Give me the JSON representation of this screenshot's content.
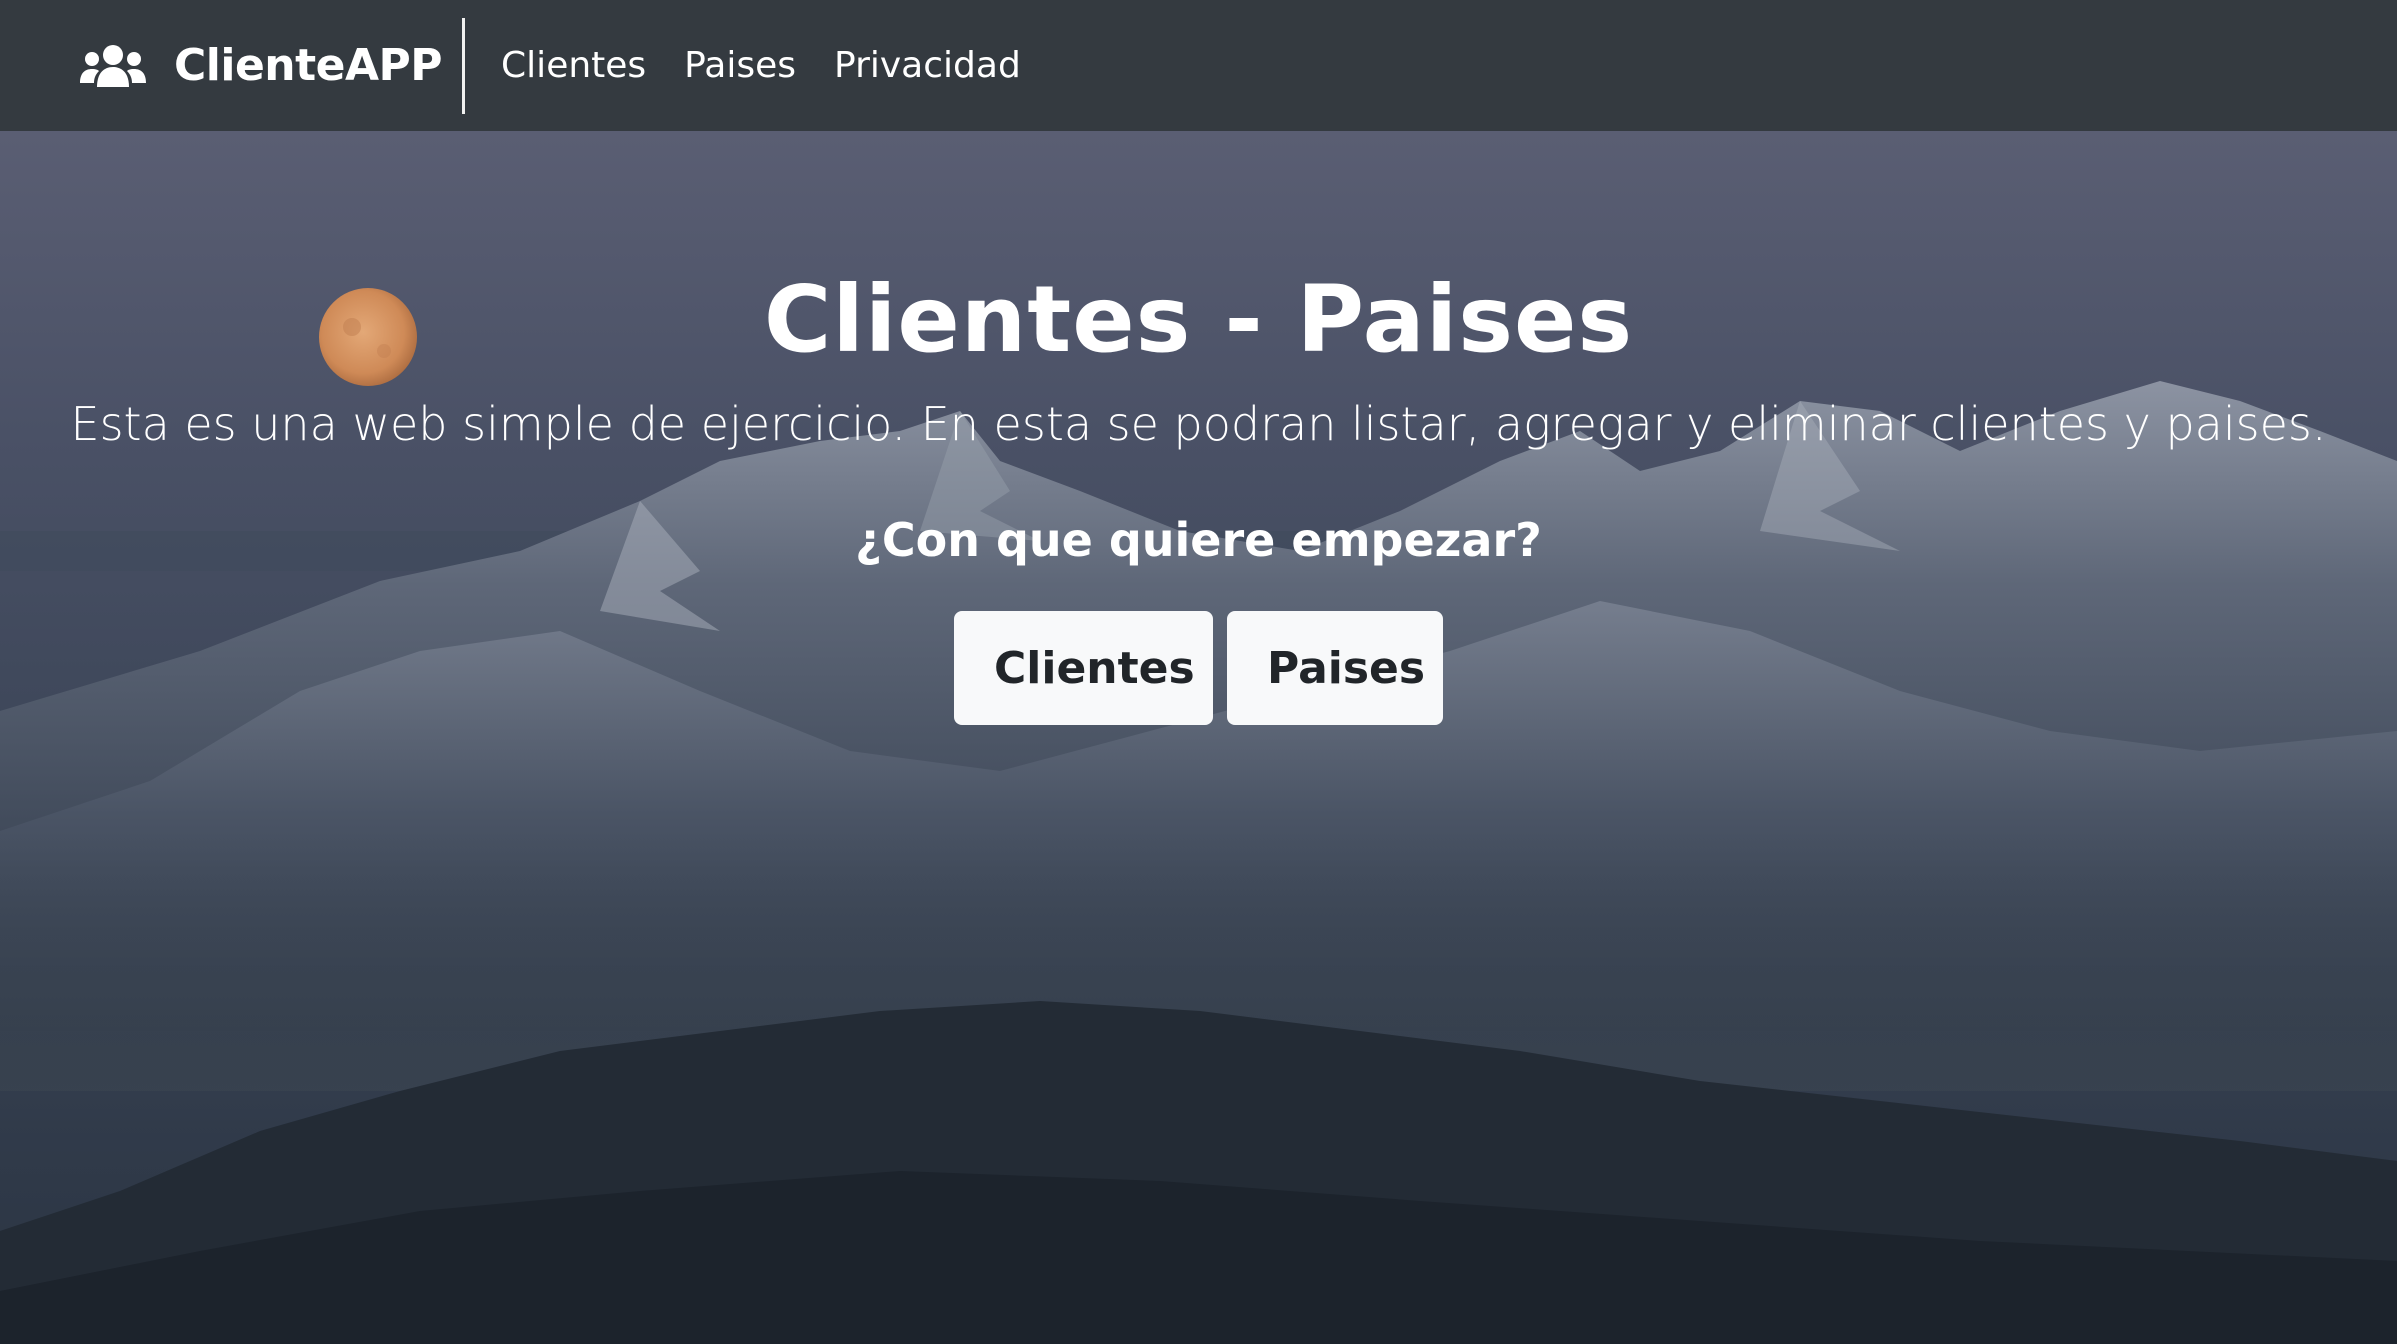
{
  "navbar": {
    "brand_icon": "users-icon",
    "brand_name": "ClienteAPP",
    "links": [
      {
        "label": "Clientes"
      },
      {
        "label": "Paises"
      },
      {
        "label": "Privacidad"
      }
    ]
  },
  "hero": {
    "title": "Clientes - Paises",
    "description": "Esta es una web simple de ejercicio. En esta se podran listar, agregar y eliminar clientes y paises.",
    "question": "¿Con que quiere empezar?",
    "buttons": {
      "clientes": "Clientes",
      "paises": "Paises"
    }
  },
  "colors": {
    "navbar_bg": "#343a40",
    "button_bg": "#f8f9fa",
    "text": "#ffffff"
  }
}
